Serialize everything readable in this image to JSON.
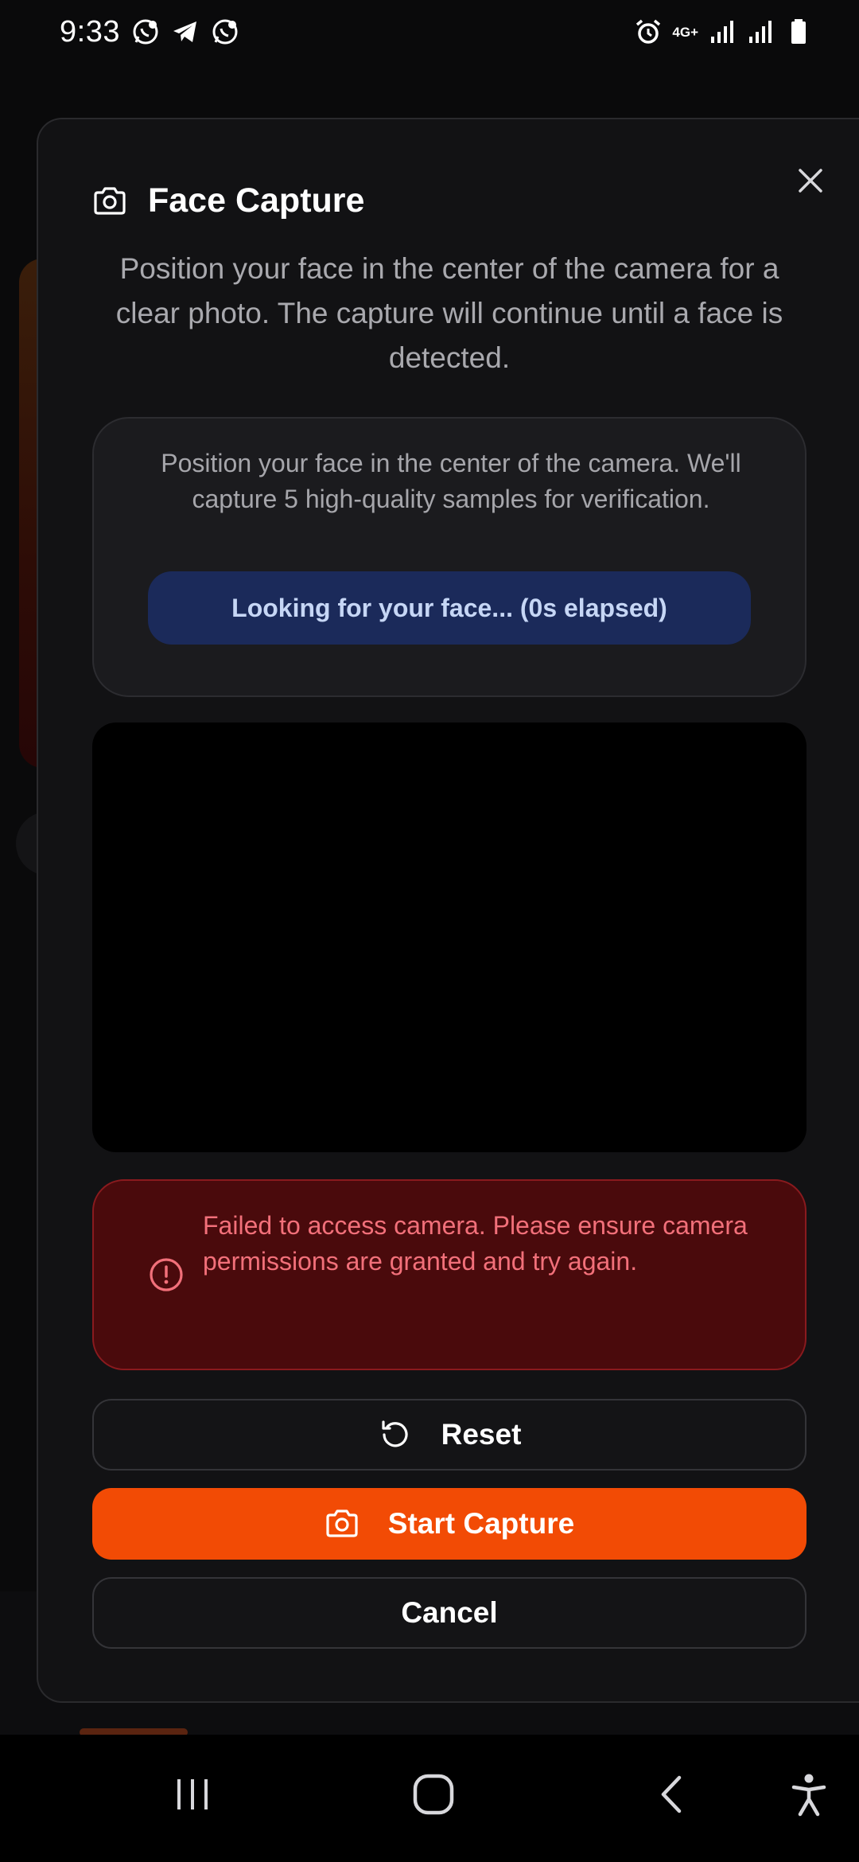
{
  "status_bar": {
    "time": "9:33",
    "network": "4G+",
    "notification_icons": [
      "whatsapp-business-icon",
      "telegram-icon",
      "whatsapp-business-icon"
    ],
    "system_icons": [
      "alarm-icon",
      "signal-icon",
      "signal-icon",
      "battery-icon"
    ]
  },
  "modal": {
    "title": "Face Capture",
    "title_icon": "camera-icon",
    "description": "Position your face in the center of the camera for a clear photo. The capture will continue until a face is detected.",
    "info_text": "Position your face in the center of the camera. We'll capture 5 high-quality samples for verification.",
    "status_text": "Looking for your face... (0s elapsed)",
    "error_text": "Failed to access camera. Please ensure camera permissions are granted and try again.",
    "buttons": {
      "reset": "Reset",
      "start_capture": "Start Capture",
      "cancel": "Cancel"
    }
  },
  "colors": {
    "accent": "#f24b05",
    "status_pill": "#1b2a5a",
    "error_bg": "#4a0a0c",
    "error_text": "#f2707a"
  },
  "system_nav": {
    "buttons": [
      "recents-icon",
      "home-icon",
      "back-icon",
      "accessibility-icon"
    ]
  }
}
